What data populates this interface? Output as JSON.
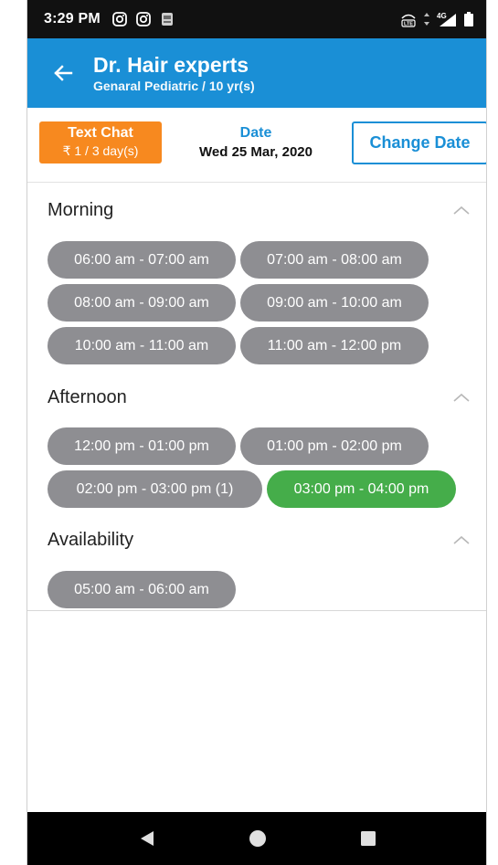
{
  "status_bar": {
    "time": "3:29 PM",
    "left_icons": [
      "instagram-icon",
      "instagram-icon",
      "app-notification-icon"
    ],
    "right_icons": [
      "volte-icon",
      "data-arrows-icon",
      "4g-signal-icon",
      "battery-icon"
    ],
    "network_label": "4G"
  },
  "app_bar": {
    "back_icon": "arrow-left-icon",
    "title": "Dr. Hair experts",
    "subtitle": "Genaral Pediatric / 10 yr(s)",
    "color": "#1a8fd6"
  },
  "consult": {
    "type_label": "Text Chat",
    "price_label": "₹ 1 / 3 day(s)",
    "badge_color": "#f7891f"
  },
  "date": {
    "label": "Date",
    "value": "Wed 25 Mar, 2020"
  },
  "change_date_label": "Change Date",
  "sections": {
    "morning": {
      "title": "Morning",
      "slots": [
        "06:00 am - 07:00 am",
        "07:00 am - 08:00 am",
        "08:00 am - 09:00 am",
        "09:00 am - 10:00 am",
        "10:00 am - 11:00 am",
        "11:00 am - 12:00 pm"
      ]
    },
    "afternoon": {
      "title": "Afternoon",
      "slots": [
        "12:00 pm - 01:00 pm",
        "01:00 pm - 02:00 pm",
        "02:00 pm - 03:00 pm (1)",
        "03:00 pm - 04:00 pm"
      ],
      "selected_slot": "03:00 pm - 04:00 pm"
    },
    "availability": {
      "title": "Availability",
      "slots": [
        "05:00 am - 06:00 am"
      ]
    }
  },
  "colors": {
    "slot_default": "#8e8e92",
    "slot_selected": "#45ad4a"
  },
  "nav_bar": {
    "buttons": [
      "back-triangle-icon",
      "home-circle-icon",
      "recents-square-icon"
    ]
  }
}
